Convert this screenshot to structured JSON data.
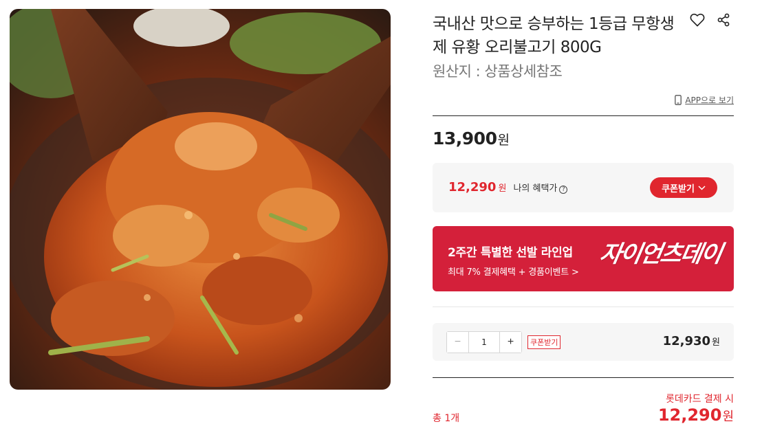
{
  "product": {
    "title": "국내산 맛으로 승부하는 1등급 무항생제 유황 오리불고기 800G",
    "origin": "원산지 : 상품상세참조",
    "image_icon": "spicy-duck-bulgogi-photo"
  },
  "actions": {
    "wishlist_icon": "heart-icon",
    "share_icon": "share-icon",
    "app_view_label": "APP으로 보기",
    "app_view_icon": "mobile-phone-icon"
  },
  "price": {
    "value": "13,900",
    "unit": "원"
  },
  "benefit": {
    "value": "12,290",
    "unit": "원",
    "label": "나의 혜택가",
    "help_icon": "question-circle-icon",
    "coupon_button": "쿠폰받기"
  },
  "banner": {
    "title": "2주간 특별한 선발 라인업",
    "subtitle": "최대 7% 결제혜택 + 경품이벤트 >",
    "logo_text": "자이언츠데이",
    "color": "#d4203a"
  },
  "quantity": {
    "value": "1",
    "minus": "−",
    "plus": "+",
    "coupon_tag": "쿠폰받기",
    "line_price": "12,930",
    "unit": "원"
  },
  "total": {
    "card_label": "롯데카드 결제 시",
    "count": "총 1개",
    "value": "12,290",
    "unit": "원"
  },
  "colors": {
    "accent_red": "#e0262e",
    "panel_bg": "#f6f6f6"
  }
}
